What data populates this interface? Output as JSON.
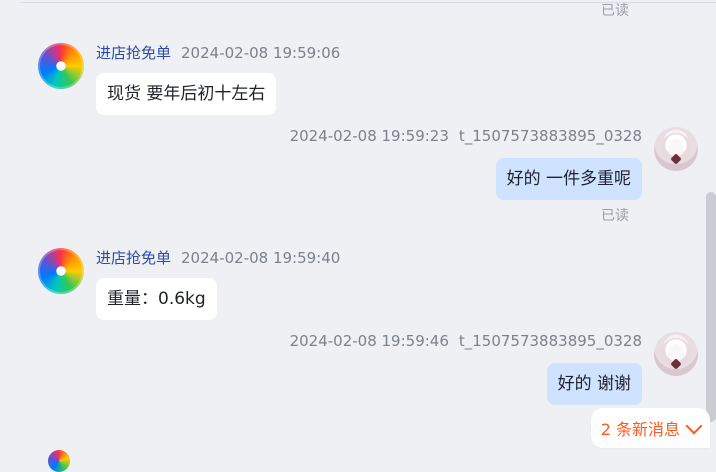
{
  "messages": [
    {
      "type": "read_receipt",
      "label": "已读"
    },
    {
      "direction": "incoming",
      "sender": "进店抢免单",
      "timestamp": "2024-02-08 19:59:06",
      "text": "现货 要年后初十左右"
    },
    {
      "direction": "outgoing",
      "timestamp": "2024-02-08 19:59:23",
      "sender": "t_1507573883895_0328",
      "text": "好的 一件多重呢",
      "read": "已读"
    },
    {
      "direction": "incoming",
      "sender": "进店抢免单",
      "timestamp": "2024-02-08 19:59:40",
      "text": "重量：0.6kg"
    },
    {
      "direction": "outgoing",
      "timestamp": "2024-02-08 19:59:46",
      "sender": "t_1507573883895_0328",
      "text": "好的 谢谢"
    }
  ],
  "new_messages": {
    "label": "2 条新消息"
  },
  "colors": {
    "background": "#eef0f3",
    "incoming_bubble": "#ffffff",
    "outgoing_bubble": "#cfe2ff",
    "sender_name": "#2e4aa6",
    "new_messages": "#ff5a1f"
  },
  "icons": {
    "incoming_avatar": "rainbow-swirl-avatar",
    "outgoing_avatar": "anime-girl-avatar",
    "new_messages_chevron": "chevron-down-icon"
  }
}
